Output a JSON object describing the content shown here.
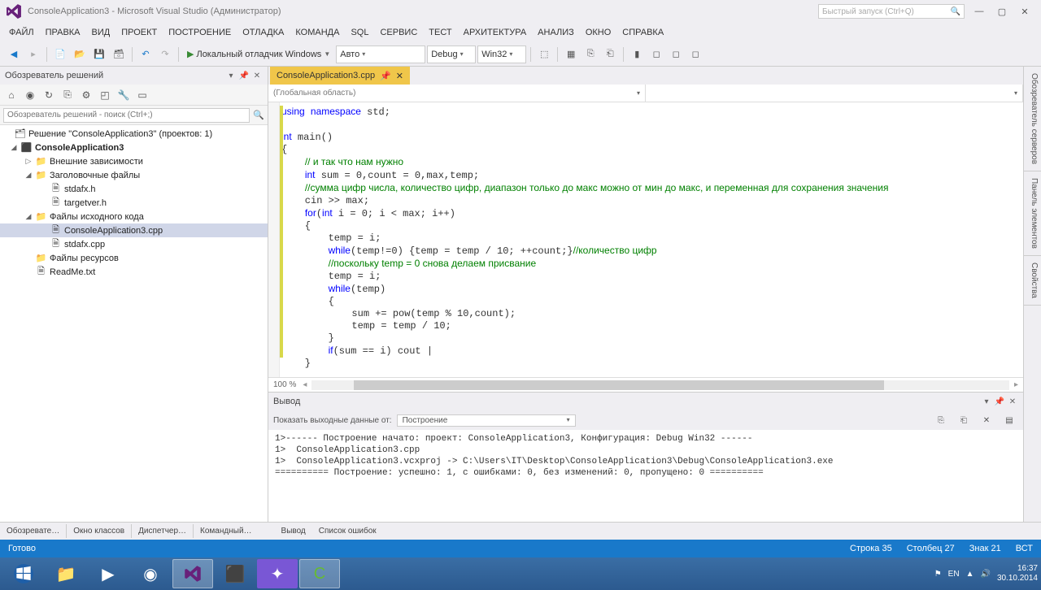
{
  "title": "ConsoleApplication3 - Microsoft Visual Studio (Администратор)",
  "quicklaunch": {
    "placeholder": "Быстрый запуск (Ctrl+Q)"
  },
  "menu": [
    "ФАЙЛ",
    "ПРАВКА",
    "ВИД",
    "ПРОЕКТ",
    "ПОСТРОЕНИЕ",
    "ОТЛАДКА",
    "КОМАНДА",
    "SQL",
    "СЕРВИС",
    "ТЕСТ",
    "АРХИТЕКТУРА",
    "АНАЛИЗ",
    "ОКНО",
    "СПРАВКА"
  ],
  "toolbar": {
    "debugger": "Локальный отладчик Windows",
    "platform_cfg": "Авто",
    "config": "Debug",
    "platform": "Win32"
  },
  "right_tabs": [
    "Обозреватель серверов",
    "Панель элементов",
    "Свойства"
  ],
  "solution_explorer": {
    "title": "Обозреватель решений",
    "search_placeholder": "Обозреватель решений - поиск (Ctrl+;)",
    "nodes": {
      "solution": "Решение \"ConsoleApplication3\" (проектов: 1)",
      "project": "ConsoleApplication3",
      "ext_deps": "Внешние зависимости",
      "headers": "Заголовочные файлы",
      "h1": "stdafx.h",
      "h2": "targetver.h",
      "sources": "Файлы исходного кода",
      "s1": "ConsoleApplication3.cpp",
      "s2": "stdafx.cpp",
      "resources": "Файлы ресурсов",
      "readme": "ReadMe.txt"
    }
  },
  "editor": {
    "tab": "ConsoleApplication3.cpp",
    "scope": "(Глобальная область)",
    "zoom": "100 %",
    "code_html": "<span class='kw'>using</span> <span class='kw'>namespace</span> std;\n\n<span class='kw'>int</span> main()\n{\n    <span class='cm'>// и так что нам нужно</span>\n    <span class='kw'>int</span> sum = 0,count = 0,max,temp;\n    <span class='cm'>//сумма цифр числа, количество цифр, диапазон только до макс можно от мин до макс, и переменная для сохранения значения</span>\n    cin &gt;&gt; max;\n    <span class='kw'>for</span>(<span class='kw'>int</span> i = 0; i &lt; max; i++)\n    {\n        temp = i;\n        <span class='kw'>while</span>(temp!=0) {temp = temp / 10; ++count;}<span class='cm'>//количество цифр</span>\n        <span class='cm'>//поскольку temp = 0 снова делаем присвание</span>\n        temp = i;\n        <span class='kw'>while</span>(temp)\n        {\n            sum += pow(temp % 10,count);\n            temp = temp / 10;\n        }\n        <span class='kw'>if</span>(sum == i) cout |\n    }"
  },
  "output": {
    "title": "Вывод",
    "filter_label": "Показать выходные данные от:",
    "filter_value": "Построение",
    "text": "1>------ Построение начато: проект: ConsoleApplication3, Конфигурация: Debug Win32 ------\n1>  ConsoleApplication3.cpp\n1>  ConsoleApplication3.vcxproj -> C:\\Users\\IT\\Desktop\\ConsoleApplication3\\Debug\\ConsoleApplication3.exe\n========== Построение: успешно: 1, с ошибками: 0, без изменений: 0, пропущено: 0 =========="
  },
  "bottom_tabs": {
    "left": [
      "Обозревате…",
      "Окно классов",
      "Диспетчер…",
      "Командный…"
    ],
    "right": [
      "Вывод",
      "Список ошибок"
    ]
  },
  "status": {
    "ready": "Готово",
    "line": "Строка 35",
    "col": "Столбец 27",
    "char": "Знак 21",
    "ins": "ВСТ"
  },
  "tray": {
    "lang": "EN",
    "time": "16:37",
    "date": "30.10.2014"
  }
}
